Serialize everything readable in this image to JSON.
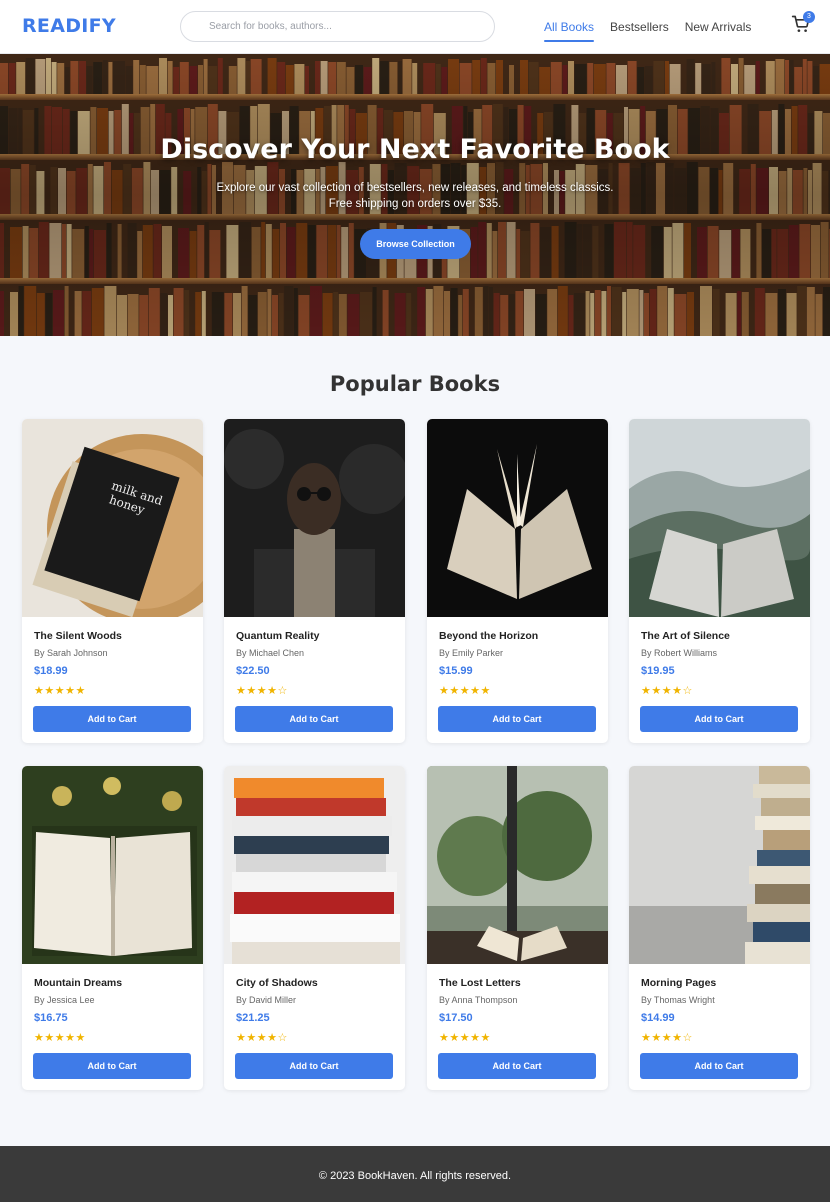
{
  "header": {
    "logo": "READIFY",
    "search_placeholder": "Search for books, authors...",
    "nav": [
      "All Books",
      "Bestsellers",
      "New Arrivals"
    ],
    "cart_count": "3"
  },
  "hero": {
    "title": "Discover Your Next Favorite Book",
    "subtitle_line1": "Explore our vast collection of bestsellers, new releases, and timeless classics.",
    "subtitle_line2": "Free shipping on orders over $35.",
    "button": "Browse Collection"
  },
  "section_title": "Popular Books",
  "add_to_cart_label": "Add to Cart",
  "books": [
    {
      "title": "The Silent Woods",
      "author": "By Sarah Johnson",
      "price": "$18.99",
      "rating": 5
    },
    {
      "title": "Quantum Reality",
      "author": "By Michael Chen",
      "price": "$22.50",
      "rating": 4
    },
    {
      "title": "Beyond the Horizon",
      "author": "By Emily Parker",
      "price": "$15.99",
      "rating": 5
    },
    {
      "title": "The Art of Silence",
      "author": "By Robert Williams",
      "price": "$19.95",
      "rating": 4
    },
    {
      "title": "Mountain Dreams",
      "author": "By Jessica Lee",
      "price": "$16.75",
      "rating": 5
    },
    {
      "title": "City of Shadows",
      "author": "By David Miller",
      "price": "$21.25",
      "rating": 4
    },
    {
      "title": "The Lost Letters",
      "author": "By Anna Thompson",
      "price": "$17.50",
      "rating": 5
    },
    {
      "title": "Morning Pages",
      "author": "By Thomas Wright",
      "price": "$14.99",
      "rating": 4
    }
  ],
  "footer": "© 2023 BookHaven. All rights reserved.",
  "colors": {
    "accent": "#3f7be8",
    "star": "#f0b400",
    "footer_bg": "#3a3a3a"
  }
}
